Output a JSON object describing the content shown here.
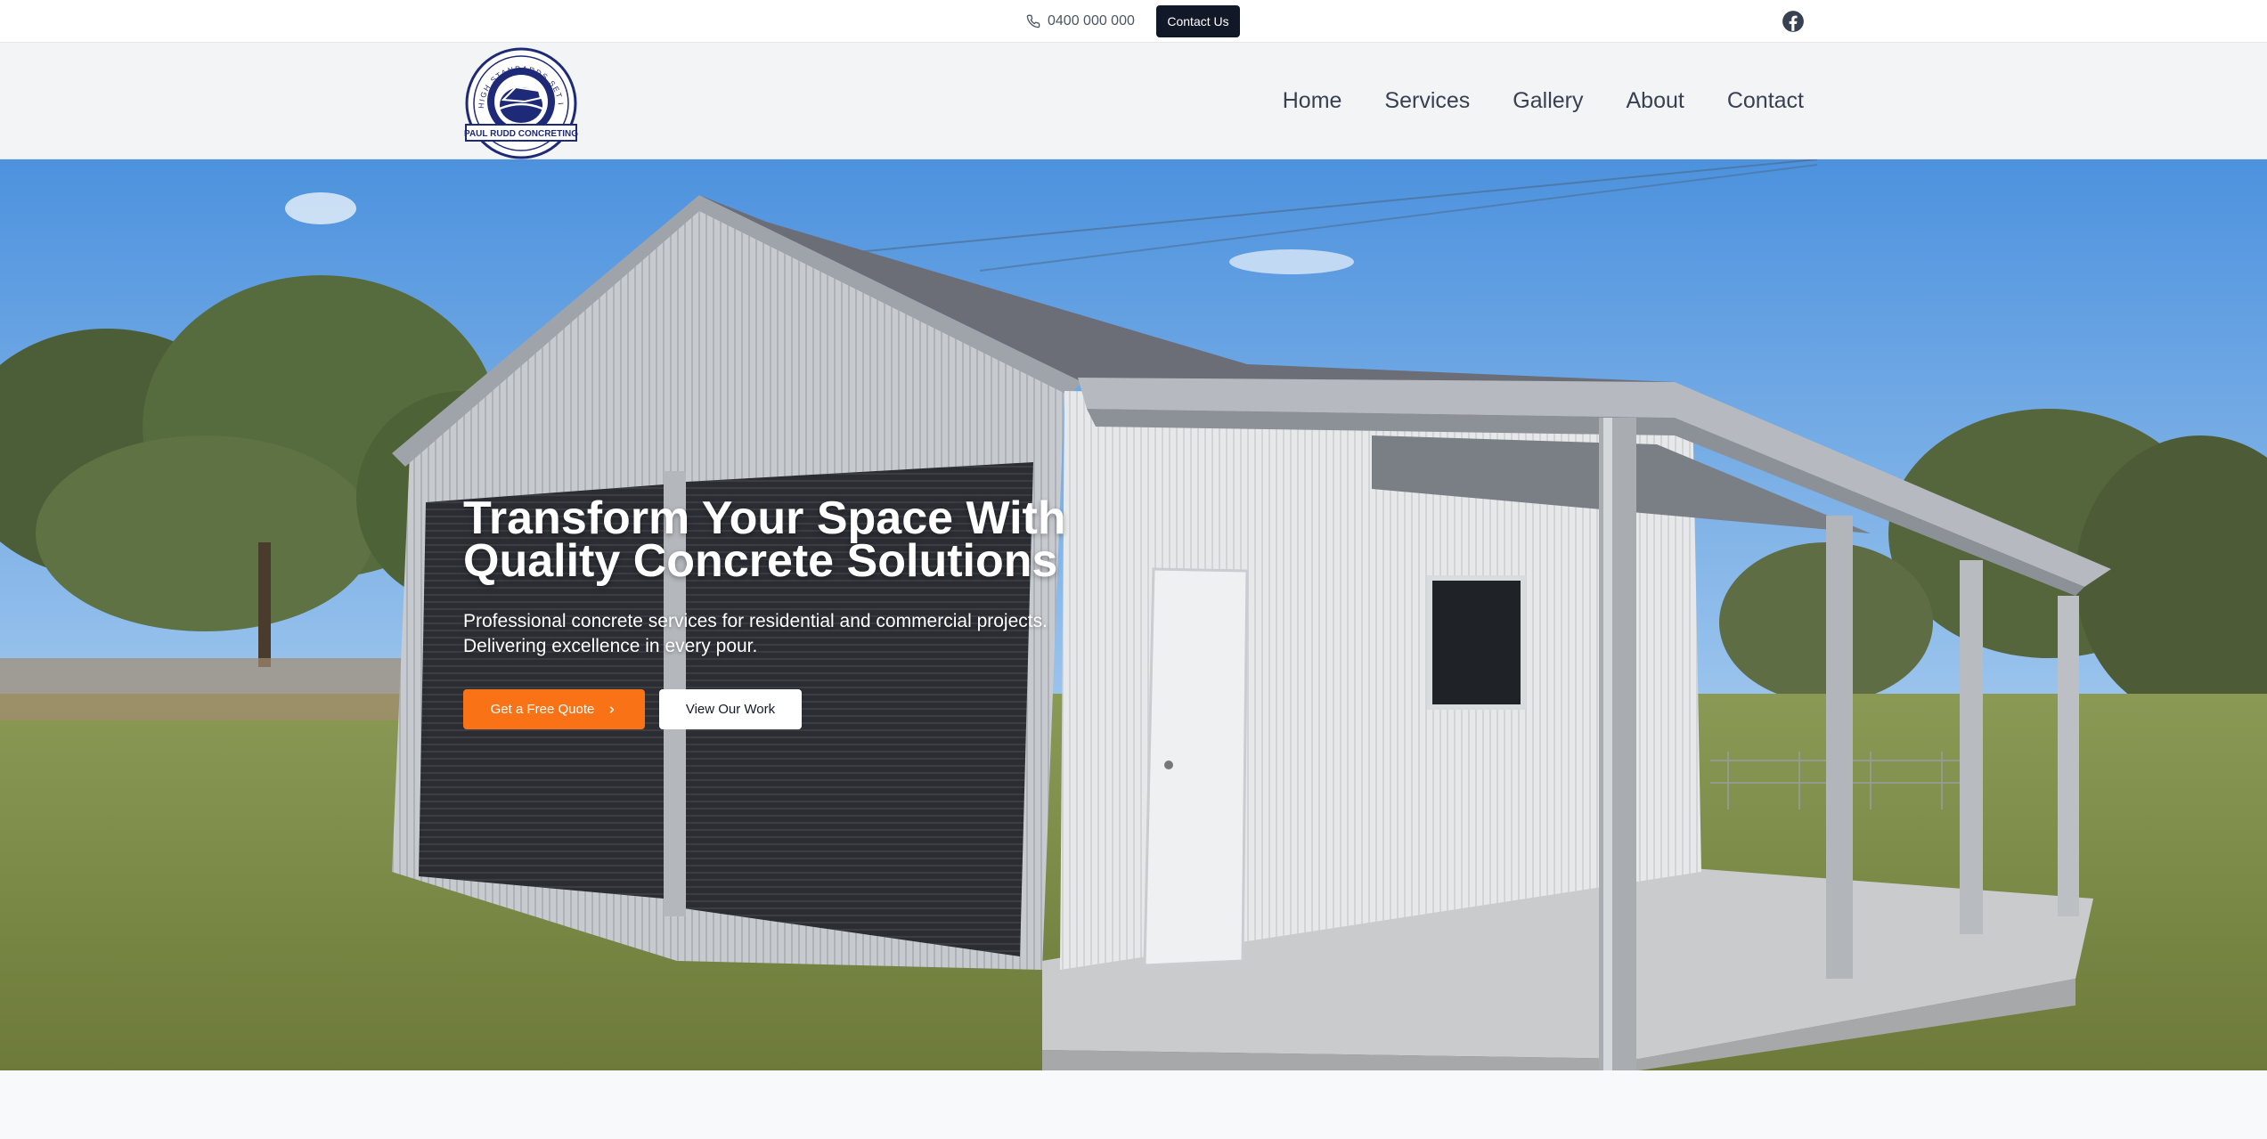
{
  "topbar": {
    "phone": "0400 000 000",
    "contact_label": "Contact Us",
    "social_icon": "facebook-icon"
  },
  "header": {
    "logo": {
      "ring_text": "HIGH STANDARDS SET IN CONCRETE",
      "banner_text": "PAUL RUDD CONCRETING"
    },
    "nav": [
      "Home",
      "Services",
      "Gallery",
      "About",
      "Contact"
    ]
  },
  "hero": {
    "title": "Transform Your Space With Quality Concrete Solutions",
    "subtitle": "Professional concrete services for residential and commercial projects. Delivering excellence in every pour.",
    "primary_cta": "Get a Free Quote",
    "secondary_cta": "View Our Work"
  },
  "colors": {
    "accent": "#f97316",
    "dark": "#111827",
    "logo_navy": "#1e2a78"
  }
}
